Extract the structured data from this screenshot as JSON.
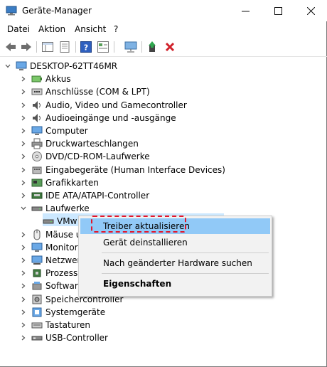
{
  "window": {
    "title": "Geräte-Manager"
  },
  "titlebar": {
    "minimize": "—",
    "maximize": "☐",
    "close": "✕"
  },
  "menu": [
    "Datei",
    "Aktion",
    "Ansicht",
    "?"
  ],
  "tree": {
    "root": "DESKTOP-62TT46MR",
    "items": [
      {
        "label": "Akkus",
        "icon": "battery-icon"
      },
      {
        "label": "Anschlüsse (COM & LPT)",
        "icon": "port-icon"
      },
      {
        "label": "Audio, Video und Gamecontroller",
        "icon": "speaker-icon"
      },
      {
        "label": "Audioeingänge und -ausgänge",
        "icon": "speaker-icon"
      },
      {
        "label": "Computer",
        "icon": "monitor-icon"
      },
      {
        "label": "Druckwarteschlangen",
        "icon": "printer-icon"
      },
      {
        "label": "DVD/CD-ROM-Laufwerke",
        "icon": "disc-icon"
      },
      {
        "label": "Eingabegeräte (Human Interface Devices)",
        "icon": "hid-icon"
      },
      {
        "label": "Grafikkarten",
        "icon": "display-adapter-icon"
      },
      {
        "label": "IDE ATA/ATAPI-Controller",
        "icon": "ide-icon"
      },
      {
        "label": "Laufwerke",
        "icon": "drive-icon"
      },
      {
        "label": "VMw",
        "icon": "drive-icon"
      },
      {
        "label": "Mäuse u",
        "icon": "mouse-icon"
      },
      {
        "label": "Monitor",
        "icon": "monitor-icon"
      },
      {
        "label": "Netzwerl",
        "icon": "network-icon"
      },
      {
        "label": "Prozesso",
        "icon": "cpu-icon"
      },
      {
        "label": "Software",
        "icon": "software-icon"
      },
      {
        "label": "Speichercontroller",
        "icon": "storage-controller-icon"
      },
      {
        "label": "Systemgeräte",
        "icon": "system-icon"
      },
      {
        "label": "Tastaturen",
        "icon": "keyboard-icon"
      },
      {
        "label": "USB-Controller",
        "icon": "usb-icon"
      }
    ]
  },
  "context_menu": {
    "items": [
      "Treiber aktualisieren",
      "Gerät deinstallieren",
      "Nach geänderter Hardware suchen",
      "Eigenschaften"
    ]
  },
  "colors": {
    "selection": "#cce8ff",
    "highlight": "#91c9f7",
    "dash": "#e3162a"
  }
}
